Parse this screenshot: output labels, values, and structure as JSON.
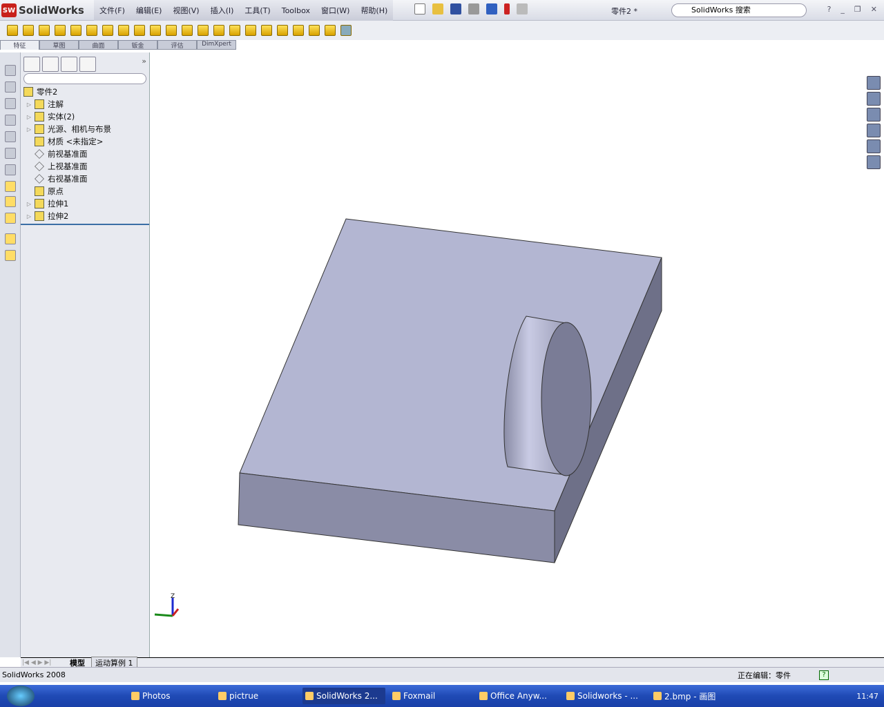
{
  "app": {
    "logo": "SolidWorks",
    "doc_title": "零件2 *",
    "search_placeholder": "SolidWorks 搜索"
  },
  "menu": [
    "文件(F)",
    "编辑(E)",
    "视图(V)",
    "插入(I)",
    "工具(T)",
    "Toolbox",
    "窗口(W)",
    "帮助(H)"
  ],
  "cm_tabs": [
    "特征",
    "草图",
    "曲面",
    "钣金",
    "评估",
    "DimXpert"
  ],
  "tree": {
    "root": "零件2",
    "items": [
      {
        "label": "注解",
        "expandable": true
      },
      {
        "label": "实体(2)",
        "expandable": true
      },
      {
        "label": "光源、相机与布景",
        "expandable": true
      },
      {
        "label": "材质 <未指定>",
        "expandable": false
      },
      {
        "label": "前视基准面",
        "expandable": false,
        "plane": true
      },
      {
        "label": "上视基准面",
        "expandable": false,
        "plane": true
      },
      {
        "label": "右视基准面",
        "expandable": false,
        "plane": true
      },
      {
        "label": "原点",
        "expandable": false
      },
      {
        "label": "拉伸1",
        "expandable": true
      },
      {
        "label": "拉伸2",
        "expandable": true
      }
    ]
  },
  "bottom_tabs": [
    "模型",
    "运动算例 1"
  ],
  "status": {
    "left": "SolidWorks 2008",
    "editing": "正在编辑：零件",
    "help": "?"
  },
  "taskbar": {
    "items": [
      "Photos",
      "pictrue",
      "SolidWorks 2...",
      "Foxmail",
      "Office Anyw...",
      "Solidworks - ...",
      "2.bmp - 画图"
    ],
    "clock": "11:47"
  },
  "triad": {
    "z": "Z"
  },
  "colors": {
    "model_top": "#b3b6d2",
    "model_front": "#8a8ca6",
    "model_side": "#6e7088"
  }
}
